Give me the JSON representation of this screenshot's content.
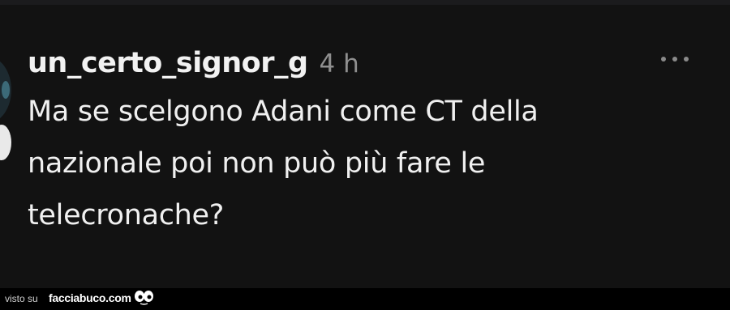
{
  "comment": {
    "username": "un_certo_signor_g",
    "time": "4 h",
    "text": "Ma se scelgono Adani come CT della nazionale poi non può più fare le telecronache?",
    "more_icon": "more-horizontal-icon"
  },
  "footer": {
    "visto": "visto su",
    "site": "facciabuco.com",
    "logo_icon": "eyes-logo-icon"
  },
  "colors": {
    "background": "#121212",
    "text": "#f0f0f0",
    "muted": "#8f8f8f"
  }
}
